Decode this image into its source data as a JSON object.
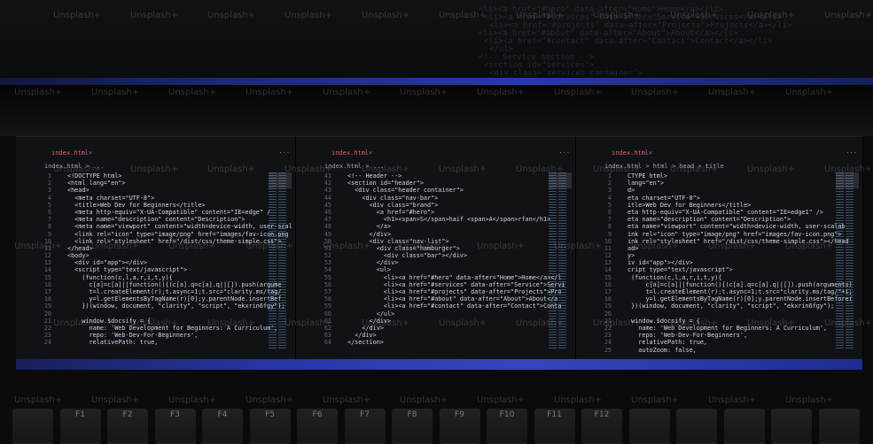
{
  "top_reflection_lines": [
    "<li><a href=\"#hero\" data-after=\"Home\">Home</a></li>",
    "<li><a href=\"#services\" data-after=\"Service\">Services</a></li>",
    "<li><a href=\"#projects\" data-after=\"Projects\">Projects</a></li>",
    "<li><a href=\"#about\" data-after=\"About\">About</a></li>",
    "<li><a href=\"#contact\" data-after=\"Contact\">Contact</a></li>",
    "</ul>",
    "<!-- Service section -->",
    "<section id=\"services\">",
    "<div class=\"services container\">"
  ],
  "panes": [
    {
      "tab": "index.html",
      "breadcrumbs": "index.html > ...",
      "lines": [
        {
          "n": "1",
          "t": "<!DOCTYPE html>"
        },
        {
          "n": "2",
          "t": "<html lang=\"en\">"
        },
        {
          "n": "3",
          "t": "<head>"
        },
        {
          "n": "4",
          "t": "  <meta charset=\"UTF-8\">"
        },
        {
          "n": "5",
          "t": "  <title>Web Dev for Beginners</title>"
        },
        {
          "n": "6",
          "t": "  <meta http-equiv=\"X-UA-Compatible\" content=\"IE=edge\" /"
        },
        {
          "n": "7",
          "t": "  <meta name=\"description\" content=\"Description\">"
        },
        {
          "n": "8",
          "t": "  <meta name=\"viewport\" content=\"width=device-width, user-scal"
        },
        {
          "n": "9",
          "t": "  <link rel=\"icon\" type=\"image/png\" href=\"images/fav-icon.png"
        },
        {
          "n": "10",
          "t": "  <link rel=\"stylesheet\" href=\"/dist/css/theme-simple.css\">"
        },
        {
          "n": "11",
          "t": "</head>"
        },
        {
          "n": "12",
          "t": "<body>"
        },
        {
          "n": "13",
          "t": "  <div id=\"app\"></div>"
        },
        {
          "n": "14",
          "t": "  <script type=\"text/javascript\">"
        },
        {
          "n": "15",
          "t": "    (function(c,l,a,r,i,t,y){"
        },
        {
          "n": "16",
          "t": "      c[a]=c[a]||function(){(c[a].q=c[a].q||[]).push(argume"
        },
        {
          "n": "17",
          "t": "      t=l.createElement(r);t.async=1;t.src=\"clarity.ms/tag/"
        },
        {
          "n": "18",
          "t": "      y=l.getElementsByTagName(r)[0];y.parentNode.insertBef"
        },
        {
          "n": "19",
          "t": "    })(window, document, \"clarity\", \"script\", \"ekxrin6fgy\");"
        },
        {
          "n": "20",
          "t": ""
        },
        {
          "n": "21",
          "t": "    window.$docsify = {"
        },
        {
          "n": "22",
          "t": "      name: 'Web Development for Beginners: A Curriculum',"
        },
        {
          "n": "23",
          "t": "      repo: 'Web-Dev-For-Beginners',"
        },
        {
          "n": "24",
          "t": "      relativePath: true,"
        }
      ]
    },
    {
      "tab": "index.html",
      "breadcrumbs": "index.html > ...",
      "lines": [
        {
          "n": "41",
          "t": "<!-- Header -->"
        },
        {
          "n": "42",
          "t": "<section id=\"header\">"
        },
        {
          "n": "43",
          "t": "  <div class=\"header container\">"
        },
        {
          "n": "44",
          "t": "    <div class=\"nav-bar\">"
        },
        {
          "n": "45",
          "t": "      <div class=\"brand\">"
        },
        {
          "n": "46",
          "t": "        <a href=\"#hero\">"
        },
        {
          "n": "47",
          "t": "          <h1><span>S</span>haif <span>A</span>rfan</h1>"
        },
        {
          "n": "48",
          "t": "        </a>"
        },
        {
          "n": "49",
          "t": "      </div>"
        },
        {
          "n": "50",
          "t": "      <div class=\"nav-list\">"
        },
        {
          "n": "51",
          "t": "        <div class=\"hamburger\">"
        },
        {
          "n": "52",
          "t": "          <div class=\"bar\"></div>"
        },
        {
          "n": "53",
          "t": "        </div>"
        },
        {
          "n": "54",
          "t": "        <ul>"
        },
        {
          "n": "55",
          "t": "          <li><a href=\"#hero\" data-after=\"Home\">Home</a></l"
        },
        {
          "n": "56",
          "t": "          <li><a href=\"#services\" data-after=\"Service\">Servi"
        },
        {
          "n": "57",
          "t": "          <li><a href=\"#projects\" data-after=\"Projects\">Pro"
        },
        {
          "n": "58",
          "t": "          <li><a href=\"#about\" data-after=\"About\">About</a"
        },
        {
          "n": "59",
          "t": "          <li><a href=\"#contact\" data-after=\"Contact\">Conta"
        },
        {
          "n": "60",
          "t": "        </ul>"
        },
        {
          "n": "61",
          "t": "      </div>"
        },
        {
          "n": "62",
          "t": "    </div>"
        },
        {
          "n": "63",
          "t": "  </div>"
        },
        {
          "n": "64",
          "t": "</section>"
        }
      ]
    },
    {
      "tab": "index.html",
      "breadcrumbs": "index.html > html > head > title",
      "lines": [
        {
          "n": "1",
          "t": "CTYPE html>"
        },
        {
          "n": "2",
          "t": "lang=\"en\">"
        },
        {
          "n": "3",
          "t": "d>"
        },
        {
          "n": "4",
          "t": "eta charset=\"UTF-8\">"
        },
        {
          "n": "5",
          "t": "itle>Web Dev for Beginners</title>"
        },
        {
          "n": "6",
          "t": "eta http-equiv=\"X-UA-Compatible\" content=\"IE=edge1\" />"
        },
        {
          "n": "7",
          "t": "eta name=\"description\" content=\"Description\">"
        },
        {
          "n": "8",
          "t": "eta name=\"viewport\" content=\"width=device-width, user-scalab"
        },
        {
          "n": "9",
          "t": "ink rel=\"icon\" type=\"image/png\" href=\"images/fav-icon.png\">"
        },
        {
          "n": "10",
          "t": "ink rel=\"stylesheet\" href=\"/dist/css/theme-simple.css\"></head"
        },
        {
          "n": "11",
          "t": "ad>"
        },
        {
          "n": "12",
          "t": "y>"
        },
        {
          "n": "13",
          "t": "iv id=\"app\"></div>"
        },
        {
          "n": "14",
          "t": "cript type=\"text/javascript\">"
        },
        {
          "n": "15",
          "t": " (function(c,l,a,r,i,t,y){"
        },
        {
          "n": "16",
          "t": "     c[a]=c[a]||function(){(c[a].q=c[a].q||[]).push(arguments)"
        },
        {
          "n": "17",
          "t": "     t=l.createElement(r);t.async=1;t.src=\"clarity.ms/tag/\"+i;"
        },
        {
          "n": "18",
          "t": "     y=l.getElementsByTagName(r)[0];y.parentNode.insertBefore("
        },
        {
          "n": "19",
          "t": " })(window, document, \"clarity\", \"script\", \"ekxrin6fgy\");"
        },
        {
          "n": "20",
          "t": ""
        },
        {
          "n": "21",
          "t": " window.$docsify = {"
        },
        {
          "n": "22",
          "t": "   name: 'Web Development for Beginners: A Curriculum',"
        },
        {
          "n": "23",
          "t": "   repo: 'Web-Dev-For-Beginners',"
        },
        {
          "n": "24",
          "t": "   relativePath: true,"
        },
        {
          "n": "25",
          "t": "   autoZoom: false,"
        }
      ]
    }
  ],
  "keys": [
    "",
    "F1",
    "F2",
    "F3",
    "F4",
    "F5",
    "F6",
    "F7",
    "F8",
    "F9",
    "F10",
    "F11",
    "F12",
    "",
    "",
    "",
    "",
    ""
  ],
  "watermark": "Unsplash+"
}
